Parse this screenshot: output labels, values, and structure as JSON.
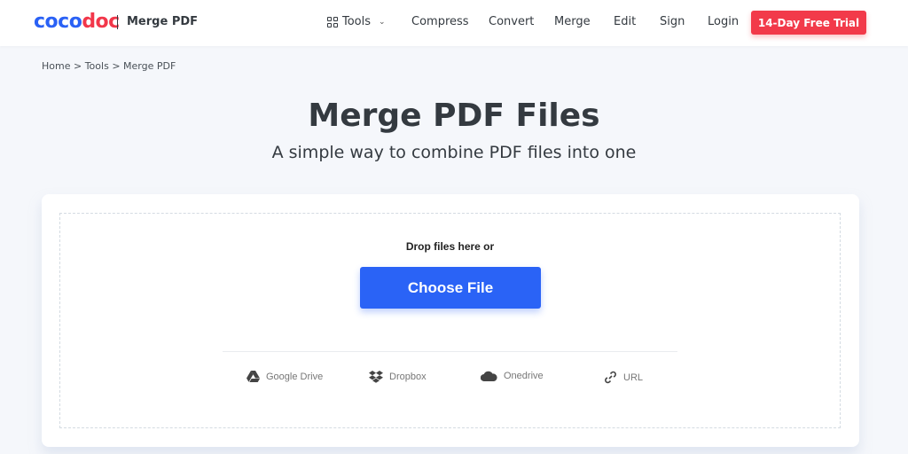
{
  "header": {
    "logo_part1": "coco",
    "logo_part2": "doc",
    "product": "Merge PDF",
    "nav": {
      "tools": "Tools",
      "compress": "Compress",
      "convert": "Convert",
      "merge": "Merge",
      "edit": "Edit",
      "sign": "Sign",
      "login": "Login"
    },
    "trial_button": "14-Day Free Trial"
  },
  "breadcrumb": {
    "items": [
      "Home",
      "Tools",
      "Merge PDF"
    ],
    "separator": ">"
  },
  "page": {
    "title": "Merge PDF Files",
    "subtitle": "A simple way to combine PDF files into one"
  },
  "upload": {
    "drop_text": "Drop files here or",
    "choose_button": "Choose File",
    "sources": {
      "google_drive": "Google Drive",
      "dropbox": "Dropbox",
      "onedrive": "Onedrive",
      "url": "URL"
    }
  },
  "colors": {
    "brand_blue": "#2a61f5",
    "brand_red": "#f2374a",
    "primary_button": "#2a63f6",
    "trial_button": "#f23a4a"
  }
}
